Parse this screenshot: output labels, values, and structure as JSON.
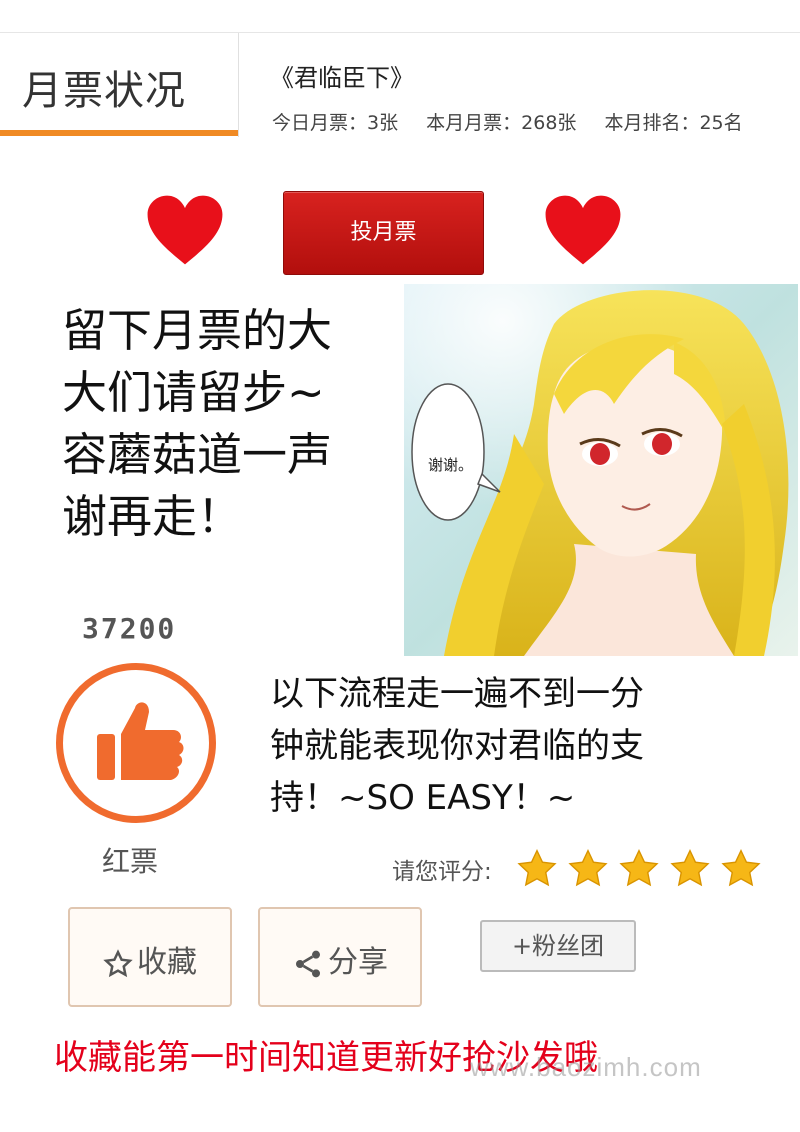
{
  "header": {
    "tab_title": "月票状况",
    "book_title": "《君临臣下》",
    "stats": {
      "today": "今日月票：3张",
      "month": "本月月票：268张",
      "rank": "本月排名：25名"
    }
  },
  "vote": {
    "button_label": "投月票",
    "heart_color": "#e8101a"
  },
  "message": {
    "lines": [
      "留下月票的大",
      "大们请留步~",
      "容蘑菇道一声",
      "谢再走！"
    ]
  },
  "illustration": {
    "speech_bubble": "谢谢。"
  },
  "red_ticket": {
    "count": "37200",
    "label": "红票"
  },
  "process_text": {
    "lines": [
      "以下流程走一遍不到一分",
      "钟就能表现你对君临的支",
      "持！~SO EASY！~"
    ]
  },
  "rating": {
    "label": "请您评分:",
    "stars": 5,
    "max": 5
  },
  "actions": {
    "collect_label": "收藏",
    "share_label": "分享",
    "fans_label": "+粉丝团"
  },
  "footer": {
    "text": "收藏能第一时间知道更新好抢沙发哦",
    "watermark": "www.baozimh.com"
  },
  "colors": {
    "accent_orange": "#f08a24",
    "thumb_orange": "#f06b2e",
    "vote_red": "#c8161d",
    "footer_red": "#e4001b",
    "star_gold": "#f6b716"
  }
}
